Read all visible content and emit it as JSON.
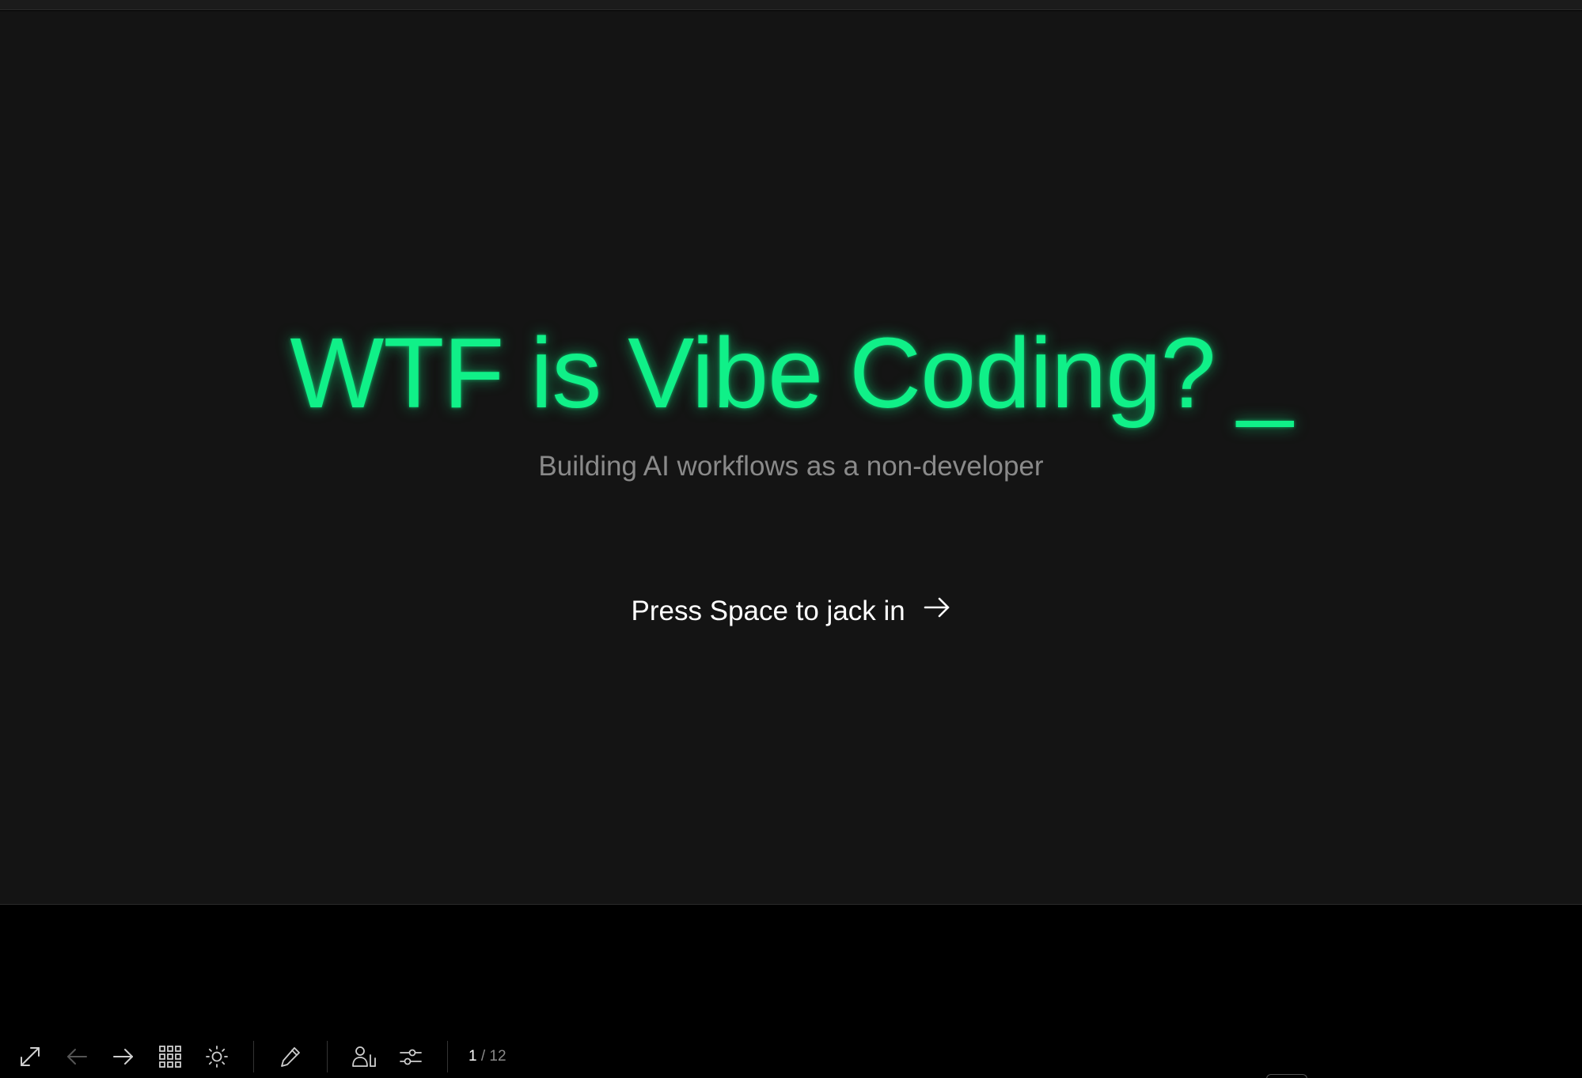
{
  "slide": {
    "title": "WTF is Vibe Coding?",
    "cursor": "_",
    "subtitle": "Building AI workflows as a non-developer",
    "cta_label": "Press Space to jack in"
  },
  "toolbar": {
    "buttons": [
      {
        "name": "fullscreen",
        "icon": "expand-icon"
      },
      {
        "name": "previous-slide",
        "icon": "arrow-left-icon"
      },
      {
        "name": "next-slide",
        "icon": "arrow-right-icon"
      },
      {
        "name": "slide-overview",
        "icon": "grid-icon"
      },
      {
        "name": "toggle-theme",
        "icon": "sun-icon"
      },
      {
        "name": "draw",
        "icon": "pencil-icon"
      },
      {
        "name": "presenter",
        "icon": "presenter-icon"
      },
      {
        "name": "settings",
        "icon": "sliders-icon"
      }
    ],
    "page_current": "1",
    "page_total": "/ 12"
  },
  "colors": {
    "accent": "#10f088",
    "slide_background": "#141414",
    "page_background": "#000000",
    "subtitle": "#8a8a8a",
    "cta": "#ffffff",
    "icon": "#cfcfcf",
    "icon_disabled": "#555555"
  }
}
